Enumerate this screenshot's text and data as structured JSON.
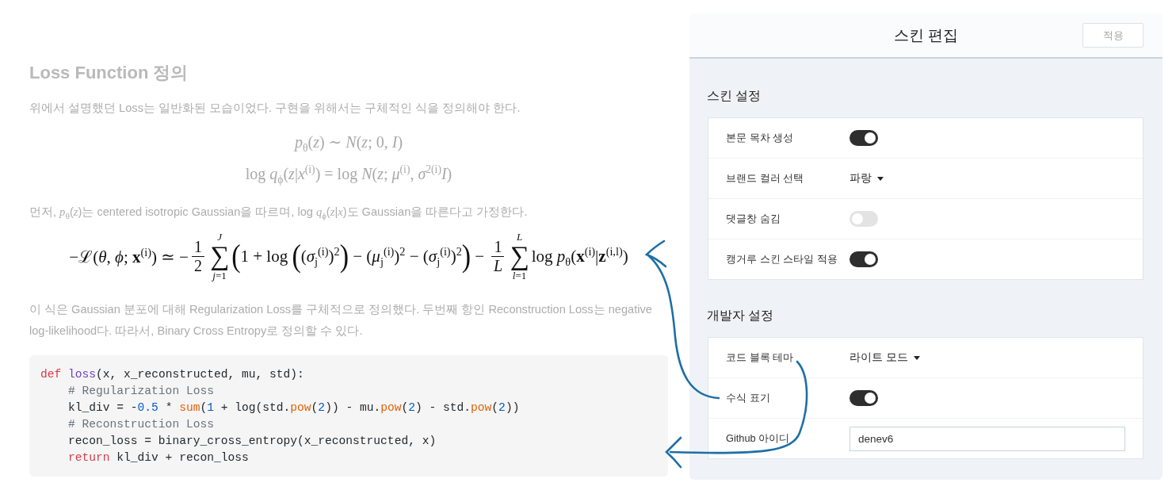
{
  "article": {
    "heading": {
      "text": "Loss Function 정의",
      "dimmed": true
    },
    "blocks": [
      {
        "kind": "paragraph",
        "dimmed": true,
        "text": "위에서 설명했던 Loss는 일반화된 모습이었다. 구현을 위해서는 구체적인 식을 정의해야 한다."
      },
      {
        "kind": "formula",
        "dimmed": true,
        "text": "*p*$_{θ}$(*z*) ∼ *N*(*z*; 0, *I*)"
      },
      {
        "kind": "formula",
        "dimmed": true,
        "text": "log *q*$_{ϕ}$(*z*|*x*$^{(i)}$) = log *N*(*z*; *μ*$^{(i)}$, *σ*$^{2(i)}$*I*)"
      },
      {
        "kind": "paragraph",
        "dimmed": true,
        "text": "먼저, *p*$_{θ}$(*z*)는 centered isotropic Gaussian을 따르며, log *q*$_{ϕ}$(*z*|*x*)도 Gaussian을 따른다고 가정한다."
      },
      {
        "kind": "display_formula",
        "dimmed": false,
        "parts": [
          {
            "kind": "text",
            "text": "−ℒ(*θ*, *ϕ*; **x**$^{(i)}$) ≃ −"
          },
          {
            "kind": "frac",
            "numerator": "1",
            "denominator": "2"
          },
          {
            "kind": "sum",
            "symbol": "∑",
            "upper": "*J*",
            "lower": "*j*=1"
          },
          {
            "kind": "big",
            "text": "("
          },
          {
            "kind": "text",
            "text": "1 + log "
          },
          {
            "kind": "big",
            "text": "("
          },
          {
            "kind": "text",
            "text": "(*σ*$_{j}$$^{(i)}$)$^{2}$"
          },
          {
            "kind": "big",
            "text": ")"
          },
          {
            "kind": "text",
            "text": " − (*μ*$_{j}$$^{(i)}$)$^{2}$ − (*σ*$_{j}$$^{(i)}$)$^{2}$"
          },
          {
            "kind": "big",
            "text": ")"
          },
          {
            "kind": "text",
            "text": " − "
          },
          {
            "kind": "frac",
            "numerator": "1",
            "denominator": "*L*"
          },
          {
            "kind": "sum",
            "symbol": "∑",
            "upper": "*L*",
            "lower": "*l*=1"
          },
          {
            "kind": "text",
            "text": "log *p*$_{θ}$(**x**$^{(i)}$|**z**$^{(i,l)}$)"
          }
        ]
      },
      {
        "kind": "paragraph",
        "dimmed": true,
        "text": "이 식은 Gaussian 분포에 대해 Regularization Loss를 구체적으로 정의했다. 두번째 항인 Reconstruction Loss는 negative log-likelihood다. 따라서, Binary Cross Entropy로 정의할 수 있다."
      },
      {
        "kind": "code",
        "dimmed": false,
        "lines": [
          {
            "tokens": [
              {
                "kind": "keyword",
                "text": "def"
              },
              {
                "kind": "function",
                "text": " loss"
              },
              {
                "kind": "plain",
                "text": "(x, x_reconstructed, mu, std):"
              }
            ],
            "children": [
              {
                "tokens": [
                  {
                    "kind": "comment",
                    "text": "# Regularization Loss"
                  }
                ]
              },
              {
                "tokens": [
                  {
                    "kind": "plain",
                    "text": "kl_div = -"
                  },
                  {
                    "kind": "number",
                    "text": "0.5"
                  },
                  {
                    "kind": "plain",
                    "text": " * "
                  },
                  {
                    "kind": "builtin",
                    "text": "sum"
                  },
                  {
                    "kind": "plain",
                    "text": "("
                  },
                  {
                    "kind": "number",
                    "text": "1"
                  },
                  {
                    "kind": "plain",
                    "text": " + log(std."
                  },
                  {
                    "kind": "builtin",
                    "text": "pow"
                  },
                  {
                    "kind": "plain",
                    "text": "("
                  },
                  {
                    "kind": "number",
                    "text": "2"
                  },
                  {
                    "kind": "plain",
                    "text": ")) - mu."
                  },
                  {
                    "kind": "builtin",
                    "text": "pow"
                  },
                  {
                    "kind": "plain",
                    "text": "("
                  },
                  {
                    "kind": "number",
                    "text": "2"
                  },
                  {
                    "kind": "plain",
                    "text": ") - std."
                  },
                  {
                    "kind": "builtin",
                    "text": "pow"
                  },
                  {
                    "kind": "plain",
                    "text": "("
                  },
                  {
                    "kind": "number",
                    "text": "2"
                  },
                  {
                    "kind": "plain",
                    "text": "))"
                  }
                ]
              },
              {
                "tokens": [
                  {
                    "kind": "comment",
                    "text": "# Reconstruction Loss"
                  }
                ]
              },
              {
                "tokens": [
                  {
                    "kind": "plain",
                    "text": "recon_loss = binary_cross_entropy(x_reconstructed, x)"
                  }
                ]
              },
              {
                "tokens": [
                  {
                    "kind": "keyword",
                    "text": "return"
                  },
                  {
                    "kind": "plain",
                    "text": " kl_div + recon_loss"
                  }
                ]
              }
            ]
          }
        ]
      }
    ]
  },
  "panel": {
    "title": "스킨 편집",
    "button": "적용",
    "sections": [
      {
        "title": "스킨 설정",
        "rows": [
          {
            "label": "본문 목차 생성",
            "kind": "toggle",
            "on": true
          },
          {
            "label": "브랜드 컬러 선택",
            "kind": "dropdown",
            "value": "파랑"
          },
          {
            "label": "댓글창 숨김",
            "kind": "toggle",
            "on": false
          },
          {
            "label": "캥거루 스킨 스타일 적용",
            "kind": "toggle",
            "on": true
          }
        ]
      },
      {
        "title": "개발자 설정",
        "rows": [
          {
            "label": "코드 블록 테마",
            "kind": "dropdown",
            "value": "라이트 모드"
          },
          {
            "label": "수식 표기",
            "kind": "toggle",
            "on": true
          },
          {
            "label": "Github 아이디",
            "kind": "input",
            "value": "denev6"
          }
        ]
      }
    ]
  }
}
